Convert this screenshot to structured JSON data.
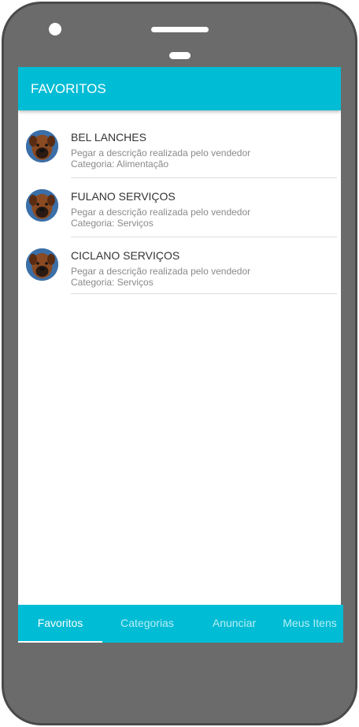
{
  "app_bar": {
    "title": "FAVORITOS"
  },
  "favorites": [
    {
      "title": "BEL LANCHES",
      "description": "Pegar a descrição realizada pelo vendedor",
      "category": "Categoria: Alimentação"
    },
    {
      "title": "FULANO SERVIÇOS",
      "description": "Pegar a descrição realizada pelo vendedor",
      "category": "Categoria: Serviços"
    },
    {
      "title": "CICLANO SERVIÇOS",
      "description": "Pegar a descrição realizada pelo vendedor",
      "category": "Categoria: Serviços"
    }
  ],
  "tabs": [
    {
      "label": "Favoritos",
      "active": true
    },
    {
      "label": "Categorias",
      "active": false
    },
    {
      "label": "Anunciar",
      "active": false
    },
    {
      "label": "Meus Itens",
      "active": false
    }
  ],
  "colors": {
    "accent": "#00bcd4",
    "phone_frame": "#6b6b6b"
  }
}
